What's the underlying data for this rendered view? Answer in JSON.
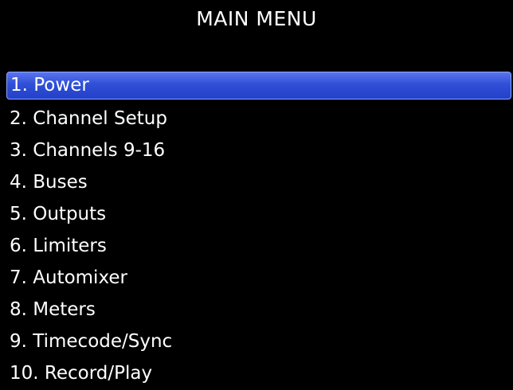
{
  "header": {
    "title": "MAIN MENU"
  },
  "menu": {
    "selected_index": 0,
    "items": [
      {
        "label": "1. Power"
      },
      {
        "label": "2. Channel Setup"
      },
      {
        "label": "3. Channels 9-16"
      },
      {
        "label": "4. Buses"
      },
      {
        "label": "5. Outputs"
      },
      {
        "label": "6. Limiters"
      },
      {
        "label": "7. Automixer"
      },
      {
        "label": "8. Meters"
      },
      {
        "label": "9. Timecode/Sync"
      },
      {
        "label": "10. Record/Play"
      }
    ]
  },
  "colors": {
    "background": "#000000",
    "text": "#ffffff",
    "selection_highlight": "#2f4fd6"
  }
}
